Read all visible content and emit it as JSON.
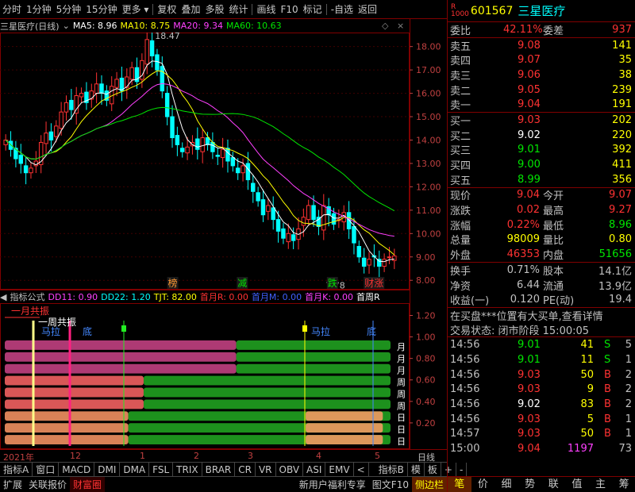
{
  "toolbar": {
    "items": [
      "分时",
      "1分钟",
      "5分钟",
      "15分钟",
      "更多",
      "复权",
      "叠加",
      "多股",
      "统计",
      "画线",
      "F10",
      "标记",
      "-自选",
      "返回"
    ]
  },
  "title_row": {
    "stock": "三星医疗(日线)",
    "ma5": "MA5: 8.96",
    "ma10": "MA10: 8.75",
    "ma20": "MA20: 9.34",
    "ma60": "MA60: 10.63",
    "colors": {
      "ma5": "#ffffff",
      "ma10": "#ffff00",
      "ma20": "#ff40ff",
      "ma60": "#00e600"
    }
  },
  "chart_data": [
    {
      "type": "candlestick",
      "title": "三星医疗(日线)",
      "ylim": [
        7.6,
        18.6
      ],
      "y_ticks": [
        "18.00",
        "17.00",
        "16.00",
        "15.00",
        "14.00",
        "13.00",
        "12.00",
        "11.00",
        "10.00",
        "9.00",
        "8.00"
      ],
      "annotations": {
        "high": "18.47",
        "low": "7.78"
      },
      "labels": [
        "榜",
        "减",
        "跌",
        "财涨"
      ],
      "closes": [
        14.0,
        13.6,
        13.2,
        13.0,
        12.6,
        12.8,
        13.1,
        13.9,
        14.3,
        14.0,
        14.6,
        15.2,
        15.6,
        15.3,
        15.9,
        16.0,
        15.6,
        16.1,
        16.4,
        16.0,
        15.7,
        16.3,
        16.6,
        16.1,
        16.7,
        17.1,
        16.5,
        17.4,
        18.3,
        17.6,
        17.0,
        16.1,
        15.0,
        14.1,
        13.8,
        13.5,
        13.7,
        13.9,
        13.6,
        14.1,
        13.8,
        13.5,
        13.3,
        13.6,
        13.1,
        12.9,
        12.6,
        12.9,
        12.3,
        11.8,
        11.4,
        10.8,
        11.2,
        10.6,
        10.1,
        9.8,
        10.0,
        9.7,
        10.2,
        10.7,
        11.2,
        10.6,
        10.3,
        11.2,
        10.8,
        10.4,
        10.6,
        10.9,
        10.2,
        9.6,
        9.0,
        8.6,
        8.9,
        9.0,
        8.6,
        8.9,
        9.0,
        9.04
      ]
    },
    {
      "type": "heatmap",
      "title": "指标公式",
      "ylim": [
        0,
        1.25
      ],
      "y_ticks": [
        "1.20",
        "1.00",
        "0.80",
        "0.60",
        "0.40",
        "0.20"
      ],
      "row_labels": [
        "月",
        "月",
        "月",
        "周",
        "周",
        "周",
        "日",
        "日",
        "日"
      ]
    }
  ],
  "indicator_row": {
    "name": "指标公式",
    "dd11": "DD11: 0.90",
    "dd22": "DD22: 1.20",
    "tjt": "TJT: 82.00",
    "r": "首月R: 0.00",
    "m": "首月M: 0.00",
    "k": "首月K: 0.00",
    "week": "首周R",
    "tags": {
      "month_resonance": "一月共振",
      "week_resonance": "一周共振",
      "bottom1": "底",
      "bottom2": "底",
      "horse1": "马拉",
      "horse2": "马拉"
    }
  },
  "dates": [
    "2021年",
    "12",
    "1",
    "2",
    "3",
    "4",
    "5",
    "日线"
  ],
  "tabs": [
    "指标A",
    "窗口",
    "MACD",
    "DMI",
    "DMA",
    "FSL",
    "TRIX",
    "BRAR",
    "CR",
    "VR",
    "OBV",
    "ASI",
    "EMV",
    "<",
    "指标B",
    "模",
    "板",
    "+",
    "-"
  ],
  "bottom": {
    "left": [
      "扩展",
      "关联报价",
      "财富圈"
    ],
    "right": [
      "新用户福利专享",
      "图文F10",
      "侧边栏"
    ]
  },
  "quote": {
    "code": "601567",
    "name": "三星医疗",
    "weibi": {
      "label": "委比",
      "value": "42.11%",
      "label2": "委差",
      "value2": "937"
    },
    "sells": [
      {
        "label": "卖五",
        "price": "9.08",
        "vol": "141"
      },
      {
        "label": "卖四",
        "price": "9.07",
        "vol": "35"
      },
      {
        "label": "卖三",
        "price": "9.06",
        "vol": "38"
      },
      {
        "label": "卖二",
        "price": "9.05",
        "vol": "239"
      },
      {
        "label": "卖一",
        "price": "9.04",
        "vol": "191"
      }
    ],
    "buys": [
      {
        "label": "买一",
        "price": "9.03",
        "vol": "202"
      },
      {
        "label": "买二",
        "price": "9.02",
        "vol": "220"
      },
      {
        "label": "买三",
        "price": "9.01",
        "vol": "392"
      },
      {
        "label": "买四",
        "price": "9.00",
        "vol": "411"
      },
      {
        "label": "买五",
        "price": "8.99",
        "vol": "356"
      }
    ],
    "stats": [
      {
        "l1": "现价",
        "v1": "9.04",
        "l2": "今开",
        "v2": "9.07"
      },
      {
        "l1": "涨跌",
        "v1": "0.02",
        "l2": "最高",
        "v2": "9.27"
      },
      {
        "l1": "涨幅",
        "v1": "0.22%",
        "l2": "最低",
        "v2": "8.96"
      },
      {
        "l1": "总量",
        "v1": "98009",
        "l2": "量比",
        "v2": "0.80"
      },
      {
        "l1": "外盘",
        "v1": "46353",
        "l2": "内盘",
        "v2": "51656"
      }
    ],
    "stats2": [
      {
        "l1": "换手",
        "v1": "0.71%",
        "l2": "股本",
        "v2": "14.1亿"
      },
      {
        "l1": "净资",
        "v1": "6.44",
        "l2": "流通",
        "v2": "13.9亿"
      },
      {
        "l1": "收益(一)",
        "v1": "0.120",
        "l2": "PE(动)",
        "v2": "19.4"
      }
    ],
    "message": "在买盘***位置有大买单,查看详情",
    "status": "交易状态: 闭市阶段 15:00:05",
    "ticks": [
      {
        "time": "14:56",
        "price": "9.01",
        "vol": "41",
        "bs": "S",
        "n": "5"
      },
      {
        "time": "14:56",
        "price": "9.01",
        "vol": "11",
        "bs": "S",
        "n": "1"
      },
      {
        "time": "14:56",
        "price": "9.03",
        "vol": "50",
        "bs": "B",
        "n": "2"
      },
      {
        "time": "14:56",
        "price": "9.03",
        "vol": "9",
        "bs": "B",
        "n": "2"
      },
      {
        "time": "14:56",
        "price": "9.02",
        "vol": "83",
        "bs": "B",
        "n": "2"
      },
      {
        "time": "14:56",
        "price": "9.03",
        "vol": "5",
        "bs": "B",
        "n": "1"
      },
      {
        "time": "14:57",
        "price": "9.03",
        "vol": "50",
        "bs": "B",
        "n": "1"
      },
      {
        "time": "15:00",
        "price": "9.04",
        "vol": "1197",
        "bs": "",
        "n": "73"
      }
    ],
    "tabs": [
      "笔",
      "价",
      "细",
      "势",
      "联",
      "值",
      "主",
      "筹"
    ]
  }
}
